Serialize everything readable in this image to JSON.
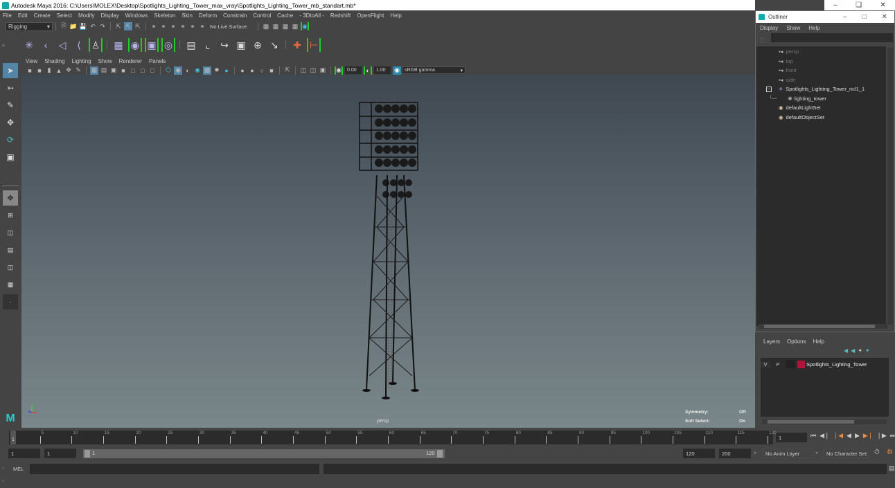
{
  "app": {
    "title": "Autodesk Maya 2016: C:\\Users\\MOLEX\\Desktop\\Spotlights_Lighting_Tower_max_vray\\Spotlights_Lighting_Tower_mb_standart.mb*",
    "window_controls": [
      "minimize",
      "restore",
      "close"
    ]
  },
  "menubar": [
    "File",
    "Edit",
    "Create",
    "Select",
    "Modify",
    "Display",
    "Windows",
    "Skeleton",
    "Skin",
    "Deform",
    "Constrain",
    "Control",
    "Cache",
    "- 3DtoAll -",
    "Redshift",
    "OpenFlight",
    "Help"
  ],
  "statusline": {
    "menuset": "Rigging",
    "live_surface": "No Live Surface"
  },
  "panel": {
    "menu": [
      "View",
      "Shading",
      "Lighting",
      "Show",
      "Renderer",
      "Panels"
    ],
    "exposure": "0.00",
    "gamma": "1.00",
    "color_space": "sRGB gamma"
  },
  "viewport": {
    "camera_label": "persp",
    "hud": [
      {
        "label": "Symmetry:",
        "value": "Off"
      },
      {
        "label": "Soft Select:",
        "value": "On"
      }
    ]
  },
  "outliner": {
    "title": "Outliner",
    "menu": [
      "Display",
      "Show",
      "Help"
    ],
    "items": [
      {
        "label": "persp",
        "icon": "camera-icon",
        "dim": true,
        "indent": 2
      },
      {
        "label": "top",
        "icon": "camera-icon",
        "dim": true,
        "indent": 2
      },
      {
        "label": "front",
        "icon": "camera-icon",
        "dim": true,
        "indent": 2
      },
      {
        "label": "side",
        "icon": "camera-icon",
        "dim": true,
        "indent": 2
      },
      {
        "label": "Spotlights_Lighting_Tower_ncl1_1",
        "icon": "group-icon",
        "dim": false,
        "indent": 2,
        "expanded": true
      },
      {
        "label": "lighting_tower",
        "icon": "mesh-icon",
        "dim": false,
        "indent": 3
      },
      {
        "label": "defaultLightSet",
        "icon": "set-icon",
        "dim": false,
        "indent": 2
      },
      {
        "label": "defaultObjectSet",
        "icon": "set-icon",
        "dim": false,
        "indent": 2
      }
    ]
  },
  "layers": {
    "menu": [
      "Layers",
      "Options",
      "Help"
    ],
    "rows": [
      {
        "v": "V",
        "p": "P",
        "color": "#b0143a",
        "name": "Spotlights_Lighting_Tower"
      }
    ]
  },
  "timeline": {
    "ticks": [
      5,
      10,
      15,
      20,
      25,
      30,
      35,
      40,
      45,
      50,
      55,
      60,
      65,
      70,
      75,
      80,
      85,
      90,
      95,
      100,
      105,
      110,
      115,
      120
    ],
    "start_label": "1",
    "current_frame": "1",
    "range_min": 1,
    "range_max": 120
  },
  "range": {
    "start": "1",
    "playback_start": "1",
    "slider_start": "1",
    "slider_end": "120",
    "playback_end": "120",
    "end": "200",
    "anim_layer": "No Anim Layer",
    "character_set": "No Character Set"
  },
  "cmdline": {
    "label": "MEL"
  }
}
